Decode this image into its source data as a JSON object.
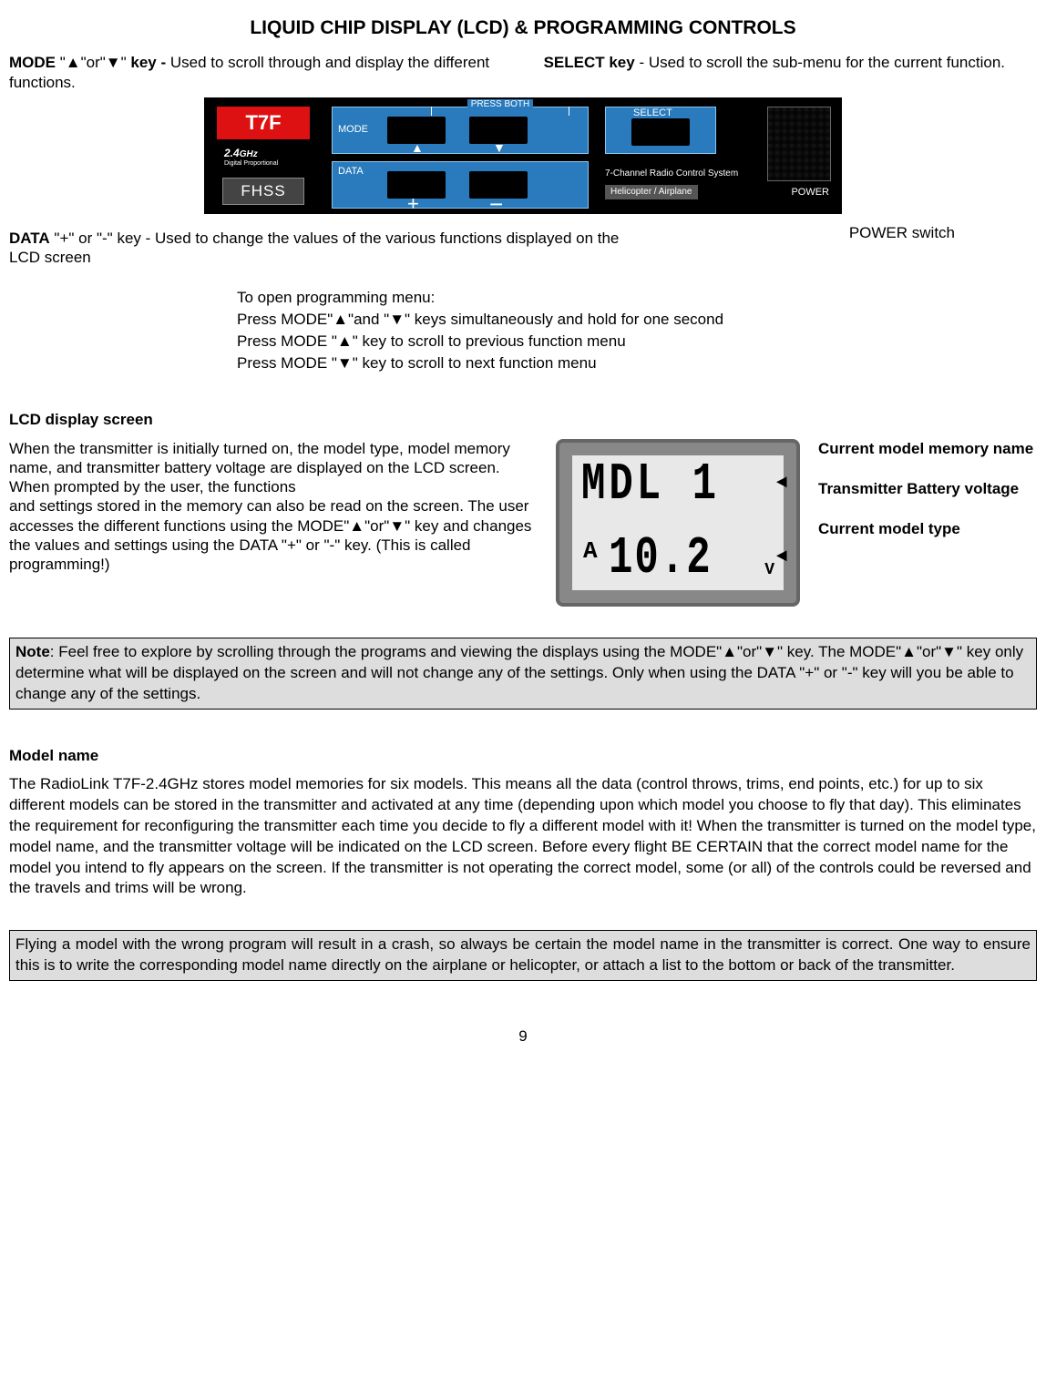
{
  "title": "LIQUID CHIP DISPLAY (LCD) & PROGRAMMING CONTROLS",
  "modeDesc": {
    "label": "MODE",
    "sym": " \"▲\"or\"▼\" ",
    "keyword": "key - ",
    "text": "Used to scroll through and display the different functions."
  },
  "selectDesc": {
    "label": "SELECT key",
    "text": " - Used to scroll the sub-menu for the current function."
  },
  "panel": {
    "model": "T7F",
    "ghz": "2.4",
    "ghzUnit": "GHz",
    "ghzSub": "Digital Proportional",
    "fhss": "FHSS",
    "modeLabel": "MODE",
    "pressBoth": "PRESS BOTH",
    "dataLabel": "DATA",
    "selectLabel": "SELECT",
    "sub1": "7-Channel Radio Control System",
    "sub2": "Helicopter / Airplane",
    "power": "POWER"
  },
  "dataDesc": {
    "label": "DATA",
    "text": "  \"+\" or \"-\" key - Used to change the values of the various functions displayed on the LCD screen"
  },
  "powerSwitch": "POWER switch",
  "prog": {
    "line1a": "To open programming menu:",
    "line1b": "Press ",
    "line1c": "MODE",
    "line1d": "\"▲\"and \"▼\"  keys simultaneously and hold for one second",
    "line2": "Press MODE \"▲\" key to scroll to previous function menu",
    "line3": "Press MODE \"▼\" key to scroll to next function menu"
  },
  "lcdHead": "LCD display screen",
  "lcdTextA": "When the transmitter is initially turned on, the ",
  "lcdBold1": "model type, model memory name,",
  "lcdTextB": " and ",
  "lcdBold2": "transmitter battery voltage",
  "lcdTextC": " are displayed on the LCD screen. When prompted by the user, the functions\nand settings stored in the memory can also be read on the screen. The user accesses the different functions using the MODE\"▲\"or\"▼\" key and changes the values and settings using the DATA \"+\" or \"-\" key. (This is called programming!)",
  "lcd": {
    "top": "MDL 1",
    "a": "A",
    "bottom": "10.2",
    "v": "V"
  },
  "lcdLabels": {
    "l1": "Current model memory name",
    "l2": "Transmitter Battery voltage",
    "l3": "Current model type"
  },
  "noteBox": {
    "noteLabel": "Note",
    "text": ": Feel free to explore by scrolling through the programs and viewing the displays using the MODE\"▲\"or\"▼\" key. The MODE\"▲\"or\"▼\" key only determine what will be displayed on the screen and will not change any of the settings. Only when using the DATA \"+\" or \"-\" key will you be able to change any of the settings."
  },
  "modelHead": "Model name",
  "modelTextA": "The RadioLink T7F-2.4GHz stores model memories for six models. This means all the data (control throws, trims, end points, etc.) for up to six different models can be stored in the transmitter and activated at any time (depending upon which model you choose to fly that day). This eliminates the requirement for reconfiguring the transmitter each time you decide to fly a different model with it! When the transmitter is turned on the ",
  "modelBold1": "model type, model name,",
  "modelTextB": " and the ",
  "modelBold2": "transmitter voltage",
  "modelTextC": " will be indicated on the LCD screen. Before every flight ",
  "modelBold3": "BE CERTAIN",
  "modelTextD": " that the correct model name for the model you intend to fly appears on the screen. If the transmitter is not operating the correct model, some (or all) of the controls could be reversed and the travels and trims will be wrong.",
  "warnBoxA": "Flying a model with the wrong program will result in a crash, so always ",
  "warnBold": "be certain",
  "warnBoxB": " the model name in the transmitter is correct. One way to ensure this is to write the corresponding model name directly on the airplane or helicopter, or attach a list to the bottom or back of the transmitter.",
  "pageNum": "9"
}
